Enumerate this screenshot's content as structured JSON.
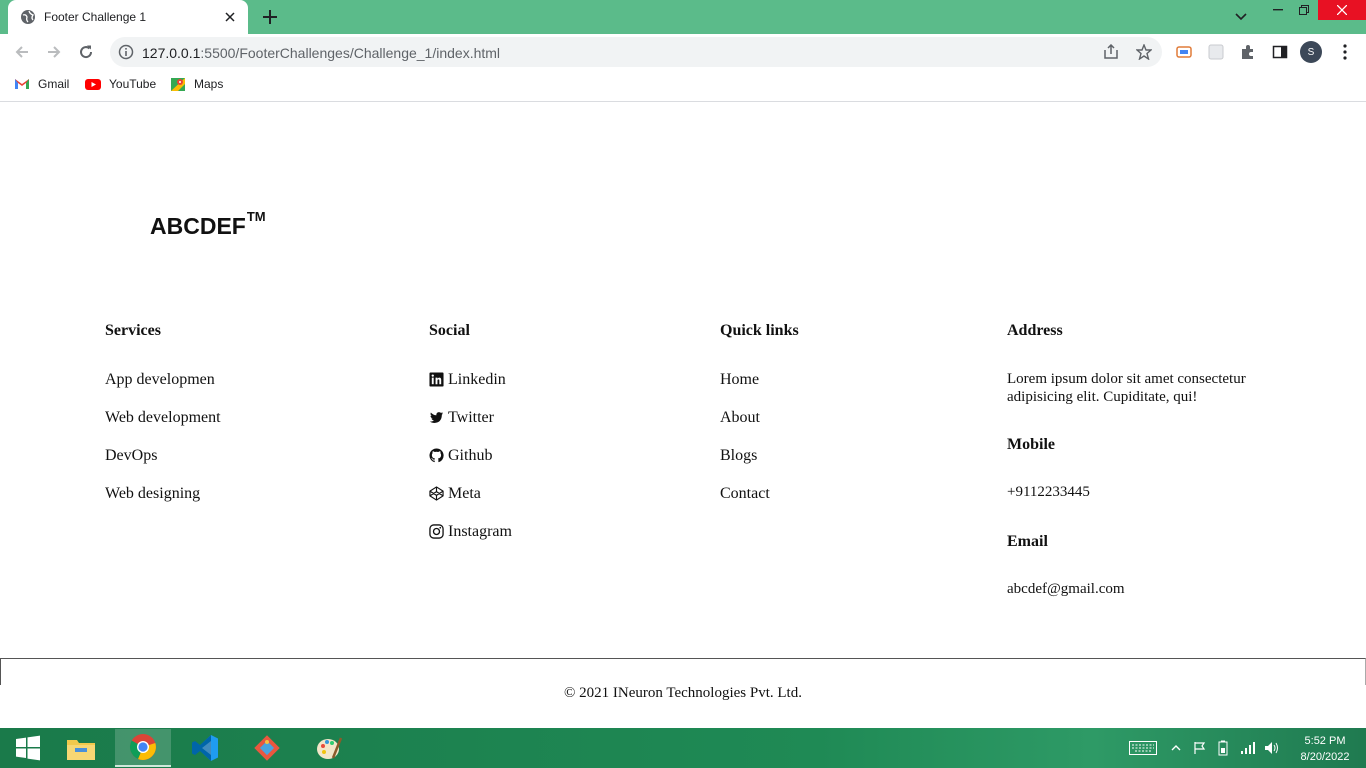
{
  "browser": {
    "tab_title": "Footer Challenge 1",
    "url_host": "127.0.0.1",
    "url_rest": ":5500/FooterChallenges/Challenge_1/index.html",
    "bookmarks": [
      {
        "label": "Gmail",
        "icon": "gmail-icon"
      },
      {
        "label": "YouTube",
        "icon": "youtube-icon"
      },
      {
        "label": "Maps",
        "icon": "maps-icon"
      }
    ],
    "profile_initial": "S",
    "tabbar_color": "#5bbb8a"
  },
  "page": {
    "brand": "ABCDEF",
    "brand_mark": "TM",
    "services": {
      "heading": "Services",
      "items": [
        "App developmen",
        "Web development",
        "DevOps",
        "Web designing"
      ]
    },
    "social": {
      "heading": "Social",
      "items": [
        {
          "label": "Linkedin",
          "icon": "linkedin-icon"
        },
        {
          "label": "Twitter",
          "icon": "twitter-icon"
        },
        {
          "label": "Github",
          "icon": "github-icon"
        },
        {
          "label": "Meta",
          "icon": "codepen-icon"
        },
        {
          "label": "Instagram",
          "icon": "instagram-icon"
        }
      ]
    },
    "quick_links": {
      "heading": "Quick links",
      "items": [
        "Home",
        "About",
        "Blogs",
        "Contact"
      ]
    },
    "address": {
      "heading": "Address",
      "text": "Lorem ipsum dolor sit amet consectetur adipisicing elit. Cupiditate, qui!",
      "mobile_heading": "Mobile",
      "mobile": "+9112233445",
      "email_heading": "Email",
      "email": "abcdef@gmail.com"
    },
    "copyright": "© 2021 INeuron Technologies Pvt. Ltd."
  },
  "taskbar": {
    "apps": [
      "file-explorer-icon",
      "chrome-icon",
      "vscode-icon",
      "git-icon",
      "paint-icon"
    ],
    "time": "5:52 PM",
    "date": "8/20/2022"
  }
}
